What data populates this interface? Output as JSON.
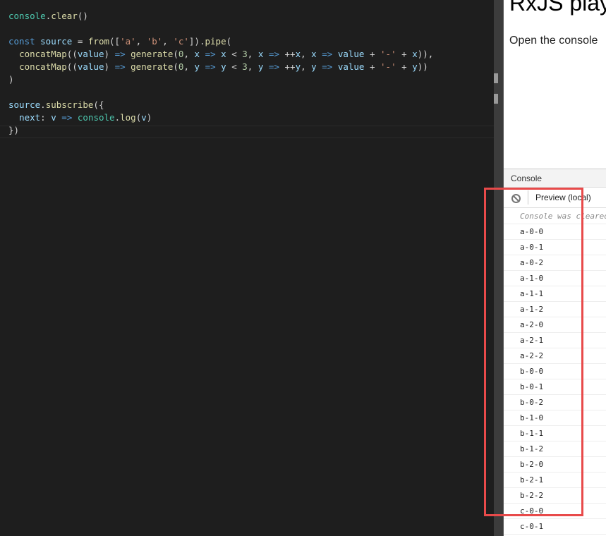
{
  "editor": {
    "code": [
      {
        "parts": [
          [
            "obj",
            "console"
          ],
          [
            "",
            "."
          ],
          [
            "fn",
            "clear"
          ],
          [
            "",
            "()"
          ]
        ]
      },
      {
        "parts": []
      },
      {
        "parts": [
          [
            "kw",
            "const "
          ],
          [
            "var",
            "source"
          ],
          [
            "",
            " = "
          ],
          [
            "fn",
            "from"
          ],
          [
            "",
            "(["
          ],
          [
            "str",
            "'a'"
          ],
          [
            "",
            ", "
          ],
          [
            "str",
            "'b'"
          ],
          [
            "",
            ", "
          ],
          [
            "str",
            "'c'"
          ],
          [
            "",
            "])."
          ],
          [
            "fn",
            "pipe"
          ],
          [
            "",
            "("
          ]
        ]
      },
      {
        "parts": [
          [
            "",
            "  "
          ],
          [
            "fn",
            "concatMap"
          ],
          [
            "",
            "(("
          ],
          [
            "var",
            "value"
          ],
          [
            "",
            ") "
          ],
          [
            "kw",
            "=>"
          ],
          [
            "",
            " "
          ],
          [
            "fn",
            "generate"
          ],
          [
            "",
            "("
          ],
          [
            "num",
            "0"
          ],
          [
            "",
            ", "
          ],
          [
            "var",
            "x"
          ],
          [
            "",
            " "
          ],
          [
            "kw",
            "=>"
          ],
          [
            "",
            " "
          ],
          [
            "var",
            "x"
          ],
          [
            "",
            " < "
          ],
          [
            "num",
            "3"
          ],
          [
            "",
            ", "
          ],
          [
            "var",
            "x"
          ],
          [
            "",
            " "
          ],
          [
            "kw",
            "=>"
          ],
          [
            "",
            " ++"
          ],
          [
            "var",
            "x"
          ],
          [
            "",
            ", "
          ],
          [
            "var",
            "x"
          ],
          [
            "",
            " "
          ],
          [
            "kw",
            "=>"
          ],
          [
            "",
            " "
          ],
          [
            "var",
            "value"
          ],
          [
            "",
            " + "
          ],
          [
            "str",
            "'-'"
          ],
          [
            "",
            " + "
          ],
          [
            "var",
            "x"
          ],
          [
            "",
            ")),"
          ]
        ]
      },
      {
        "parts": [
          [
            "",
            "  "
          ],
          [
            "fn",
            "concatMap"
          ],
          [
            "",
            "(("
          ],
          [
            "var",
            "value"
          ],
          [
            "",
            ") "
          ],
          [
            "kw",
            "=>"
          ],
          [
            "",
            " "
          ],
          [
            "fn",
            "generate"
          ],
          [
            "",
            "("
          ],
          [
            "num",
            "0"
          ],
          [
            "",
            ", "
          ],
          [
            "var",
            "y"
          ],
          [
            "",
            " "
          ],
          [
            "kw",
            "=>"
          ],
          [
            "",
            " "
          ],
          [
            "var",
            "y"
          ],
          [
            "",
            " < "
          ],
          [
            "num",
            "3"
          ],
          [
            "",
            ", "
          ],
          [
            "var",
            "y"
          ],
          [
            "",
            " "
          ],
          [
            "kw",
            "=>"
          ],
          [
            "",
            " ++"
          ],
          [
            "var",
            "y"
          ],
          [
            "",
            ", "
          ],
          [
            "var",
            "y"
          ],
          [
            "",
            " "
          ],
          [
            "kw",
            "=>"
          ],
          [
            "",
            " "
          ],
          [
            "var",
            "value"
          ],
          [
            "",
            " + "
          ],
          [
            "str",
            "'-'"
          ],
          [
            "",
            " + "
          ],
          [
            "var",
            "y"
          ],
          [
            "",
            "))"
          ]
        ]
      },
      {
        "parts": [
          [
            "",
            ")"
          ]
        ]
      },
      {
        "parts": []
      },
      {
        "parts": [
          [
            "var",
            "source"
          ],
          [
            "",
            "."
          ],
          [
            "fn",
            "subscribe"
          ],
          [
            "",
            "({"
          ]
        ]
      },
      {
        "parts": [
          [
            "",
            "  "
          ],
          [
            "var",
            "next"
          ],
          [
            "",
            ": "
          ],
          [
            "var",
            "v"
          ],
          [
            "",
            " "
          ],
          [
            "kw",
            "=>"
          ],
          [
            "",
            " "
          ],
          [
            "obj",
            "console"
          ],
          [
            "",
            "."
          ],
          [
            "fn",
            "log"
          ],
          [
            "",
            "("
          ],
          [
            "var",
            "v"
          ],
          [
            "",
            ")"
          ]
        ]
      },
      {
        "parts": [
          [
            "",
            "})"
          ]
        ]
      }
    ]
  },
  "preview": {
    "title": "RxJS playground",
    "text": "Open the console"
  },
  "console": {
    "tab_label": "Console",
    "context": "Preview (local)",
    "cleared_message": "Console was cleared",
    "logs": [
      "a-0-0",
      "a-0-1",
      "a-0-2",
      "a-1-0",
      "a-1-1",
      "a-1-2",
      "a-2-0",
      "a-2-1",
      "a-2-2",
      "b-0-0",
      "b-0-1",
      "b-0-2",
      "b-1-0",
      "b-1-1",
      "b-1-2",
      "b-2-0",
      "b-2-1",
      "b-2-2",
      "c-0-0",
      "c-0-1"
    ]
  },
  "colors": {
    "highlight": "#e84a4a"
  }
}
